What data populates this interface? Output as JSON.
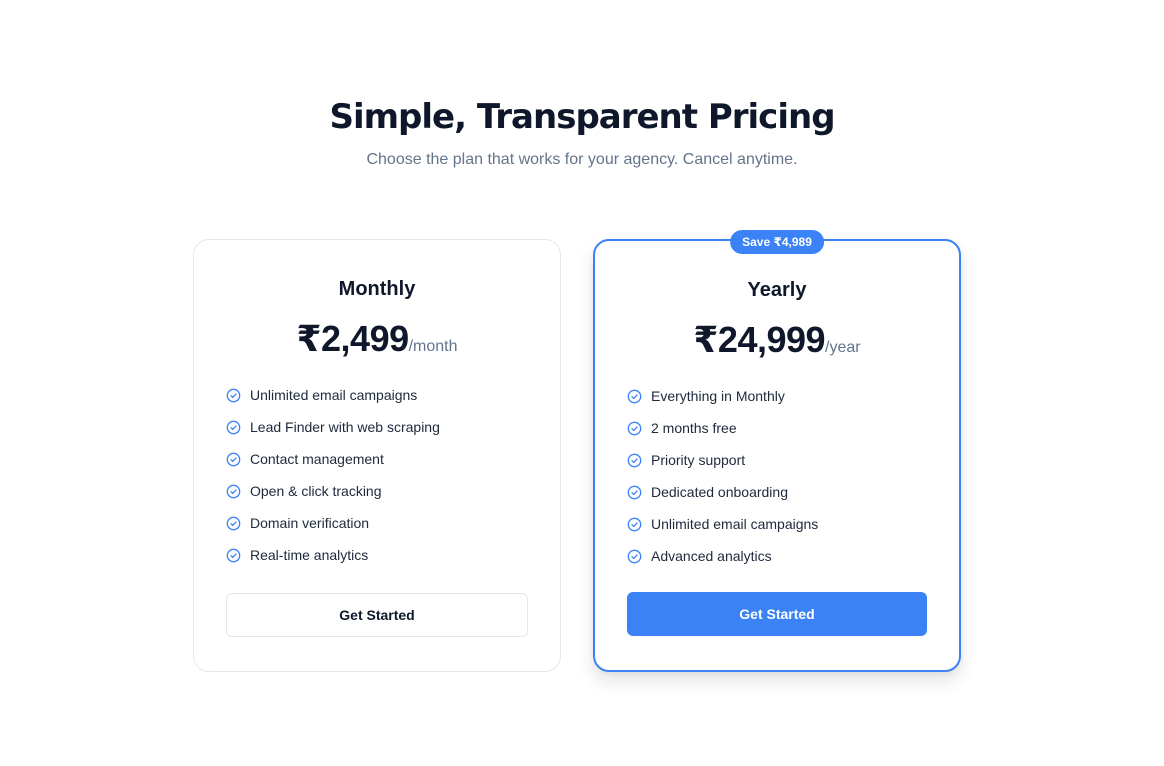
{
  "header": {
    "title": "Simple, Transparent Pricing",
    "subtitle": "Choose the plan that works for your agency. Cancel anytime."
  },
  "plans": [
    {
      "name": "Monthly",
      "price": "₹2,499",
      "period": "/month",
      "features": [
        "Unlimited email campaigns",
        "Lead Finder with web scraping",
        "Contact management",
        "Open & click tracking",
        "Domain verification",
        "Real-time analytics"
      ],
      "cta": "Get Started"
    },
    {
      "name": "Yearly",
      "badge": "Save ₹4,989",
      "price": "₹24,999",
      "period": "/year",
      "features": [
        "Everything in Monthly",
        "2 months free",
        "Priority support",
        "Dedicated onboarding",
        "Unlimited email campaigns",
        "Advanced analytics"
      ],
      "cta": "Get Started"
    }
  ],
  "colors": {
    "accent": "#3b82f6",
    "heading": "#0f172a",
    "muted": "#64748b",
    "border": "#e2e8f0"
  },
  "icons": {
    "feature_check": "check-circle-icon"
  }
}
